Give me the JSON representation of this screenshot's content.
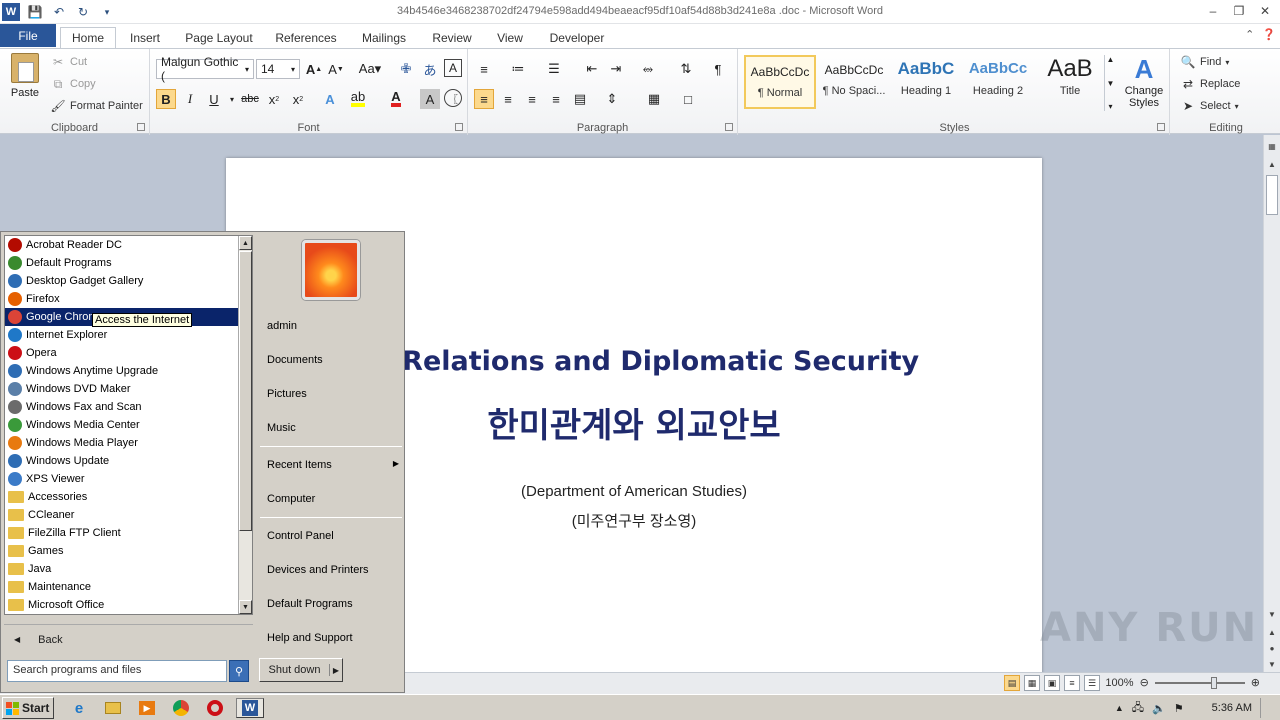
{
  "window": {
    "title": "34b4546e3468238702df24794e598add494beaeacf95df10af54d88b3d241e8a .doc - Microsoft Word"
  },
  "tabs": [
    "File",
    "Home",
    "Insert",
    "Page Layout",
    "References",
    "Mailings",
    "Review",
    "View",
    "Developer"
  ],
  "active_tab": "Home",
  "ribbon": {
    "clipboard": {
      "label": "Clipboard",
      "paste": "Paste",
      "cut": "Cut",
      "copy": "Copy",
      "format_painter": "Format Painter"
    },
    "font": {
      "label": "Font",
      "font_name": "Malgun Gothic (",
      "font_size": "14"
    },
    "paragraph": {
      "label": "Paragraph"
    },
    "styles": {
      "label": "Styles",
      "items": [
        {
          "sample": "AaBbCcDc",
          "name": "¶ Normal"
        },
        {
          "sample": "AaBbCcDc",
          "name": "¶ No Spaci..."
        },
        {
          "sample": "AaBbC",
          "name": "Heading 1"
        },
        {
          "sample": "AaBbCc",
          "name": "Heading 2"
        },
        {
          "sample": "AaB",
          "name": "Title"
        }
      ],
      "change_styles": "Change Styles"
    },
    "editing": {
      "label": "Editing",
      "find": "Find",
      "replace": "Replace",
      "select": "Select"
    }
  },
  "document": {
    "title_en": "OK Relations and Diplomatic Security",
    "title_ko": "한미관계와 외교안보",
    "subtitle1": "(Department of American Studies)",
    "subtitle2": "(미주연구부 장소영)"
  },
  "status": {
    "zoom": "100%"
  },
  "watermark": "ANY RUN",
  "start_menu": {
    "programs": [
      {
        "label": "Acrobat Reader DC",
        "icon": "acrobat-icon",
        "color": "#b30b00"
      },
      {
        "label": "Default Programs",
        "icon": "default-programs-icon",
        "color": "#3a8a2e"
      },
      {
        "label": "Desktop Gadget Gallery",
        "icon": "gadget-icon",
        "color": "#2e6db4"
      },
      {
        "label": "Firefox",
        "icon": "firefox-icon",
        "color": "#e66000"
      },
      {
        "label": "Google Chrome",
        "icon": "chrome-icon",
        "color": "#db4437"
      },
      {
        "label": "Internet Explorer",
        "icon": "ie-icon",
        "color": "#1f78c8"
      },
      {
        "label": "Opera",
        "icon": "opera-icon",
        "color": "#cc0f16"
      },
      {
        "label": "Windows Anytime Upgrade",
        "icon": "upgrade-icon",
        "color": "#2e6db4"
      },
      {
        "label": "Windows DVD Maker",
        "icon": "dvd-icon",
        "color": "#5a7fa8"
      },
      {
        "label": "Windows Fax and Scan",
        "icon": "fax-icon",
        "color": "#6b6b6b"
      },
      {
        "label": "Windows Media Center",
        "icon": "media-center-icon",
        "color": "#3a9a3a"
      },
      {
        "label": "Windows Media Player",
        "icon": "media-player-icon",
        "color": "#e87a10"
      },
      {
        "label": "Windows Update",
        "icon": "update-icon",
        "color": "#2e6db4"
      },
      {
        "label": "XPS Viewer",
        "icon": "xps-icon",
        "color": "#3b7bc8"
      },
      {
        "label": "Accessories",
        "icon": "folder-icon",
        "color": "#e8c04a"
      },
      {
        "label": "CCleaner",
        "icon": "folder-icon",
        "color": "#e8c04a"
      },
      {
        "label": "FileZilla FTP Client",
        "icon": "folder-icon",
        "color": "#e8c04a"
      },
      {
        "label": "Games",
        "icon": "folder-icon",
        "color": "#e8c04a"
      },
      {
        "label": "Java",
        "icon": "folder-icon",
        "color": "#e8c04a"
      },
      {
        "label": "Maintenance",
        "icon": "folder-icon",
        "color": "#e8c04a"
      },
      {
        "label": "Microsoft Office",
        "icon": "folder-icon",
        "color": "#e8c04a"
      }
    ],
    "highlighted_program": "Google Chrome",
    "tooltip": "Access the Internet",
    "back": "Back",
    "search_placeholder": "Search programs and files",
    "right": {
      "user": "admin",
      "documents": "Documents",
      "pictures": "Pictures",
      "music": "Music",
      "recent_items": "Recent Items",
      "computer": "Computer",
      "control_panel": "Control Panel",
      "devices_printers": "Devices and Printers",
      "default_programs": "Default Programs",
      "help_support": "Help and Support"
    },
    "shutdown": "Shut down"
  },
  "taskbar": {
    "start": "Start",
    "clock": "5:36 AM"
  }
}
